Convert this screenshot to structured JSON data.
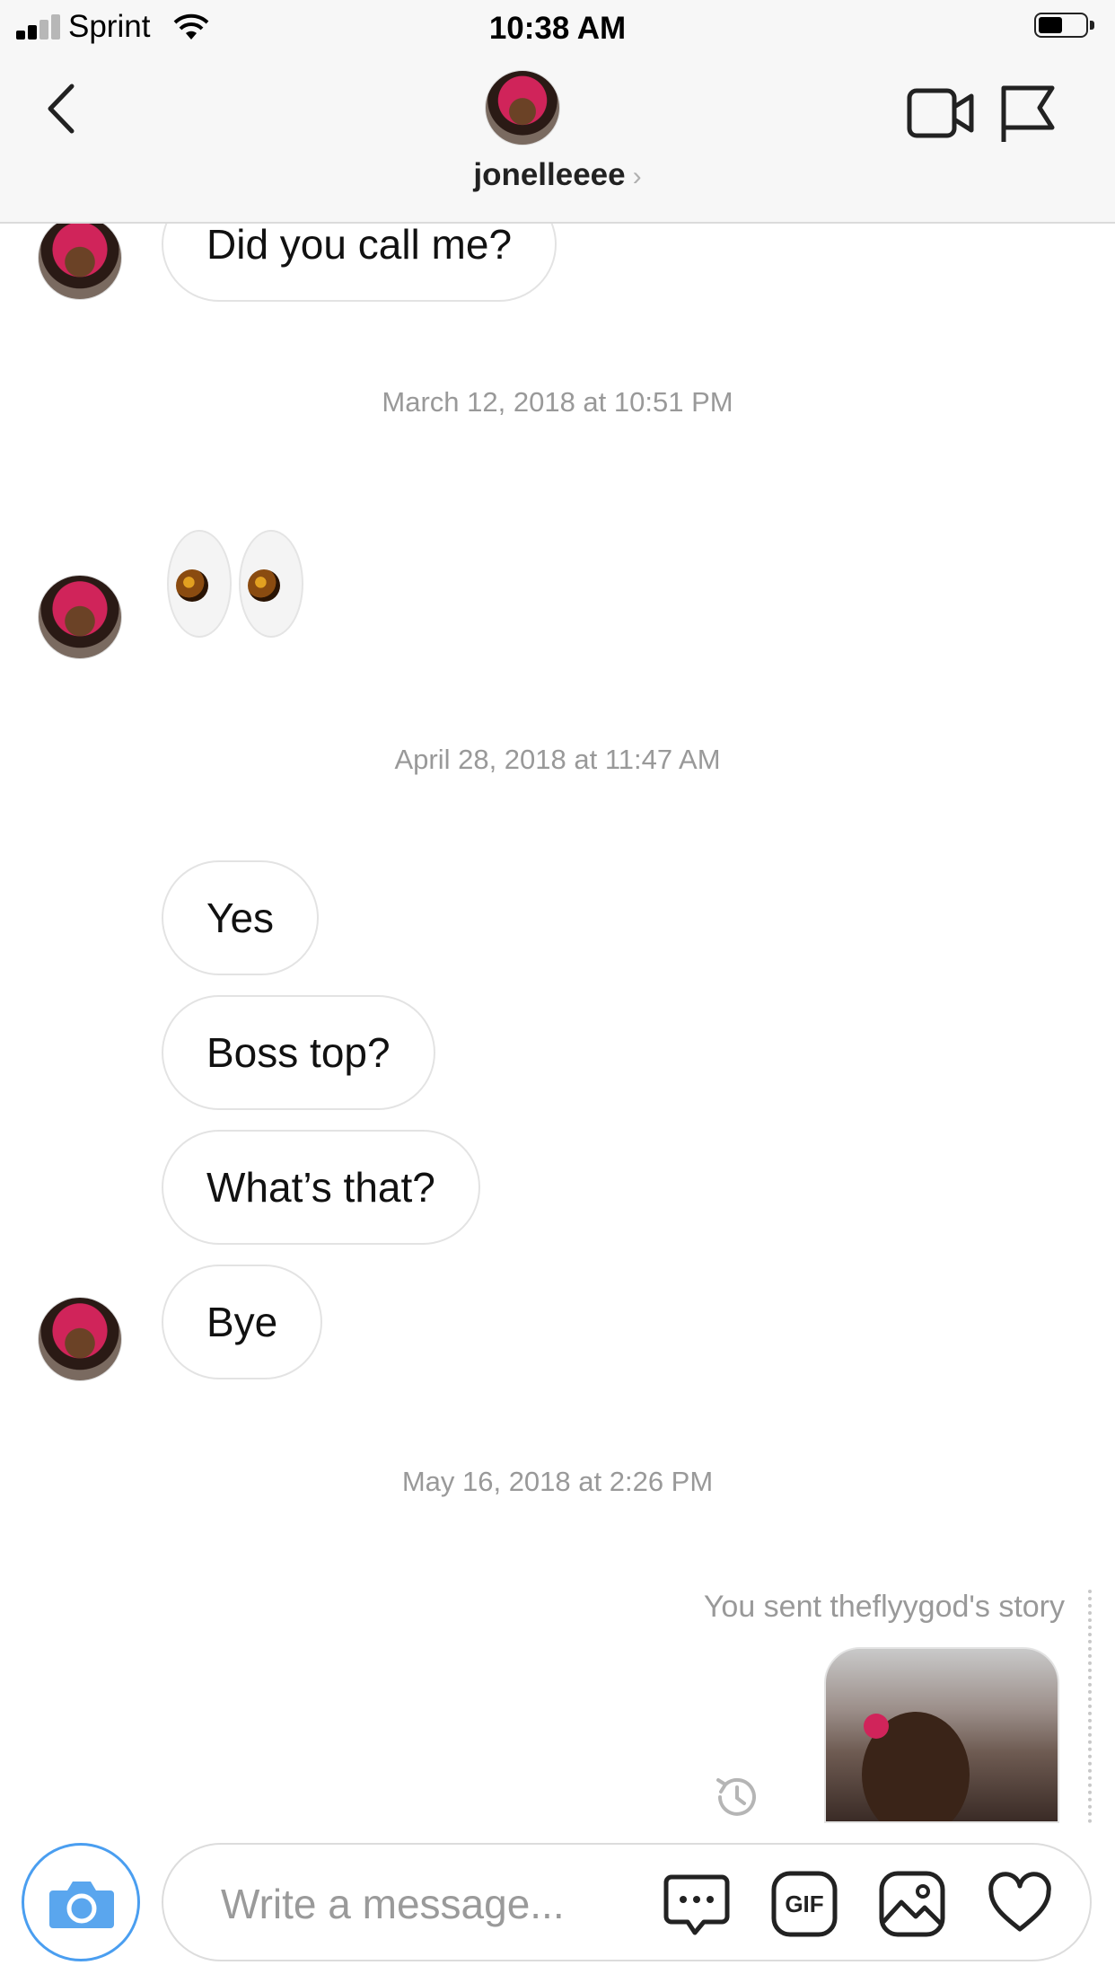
{
  "status_bar": {
    "carrier": "Sprint",
    "time": "10:38 AM"
  },
  "header": {
    "username": "jonelleeee",
    "chevron": "›"
  },
  "messages": [
    {
      "text": "Did you call me?"
    },
    {
      "timestamp": "March 12, 2018 at 10:51 PM"
    },
    {
      "emoji": "eyes"
    },
    {
      "timestamp": "April 28, 2018 at 11:47 AM"
    },
    {
      "text": "Yes"
    },
    {
      "text": "Boss top?"
    },
    {
      "text": "What’s that?"
    },
    {
      "text": "Bye"
    },
    {
      "timestamp": "May 16, 2018 at 2:26 PM"
    }
  ],
  "story": {
    "label": "You sent theflyygod's story"
  },
  "composer": {
    "placeholder": "Write a message...",
    "gif_label": "GIF"
  },
  "colors": {
    "accent": "#3897f0",
    "bubble_border": "#e3e3e3",
    "timestamp": "#999999"
  }
}
